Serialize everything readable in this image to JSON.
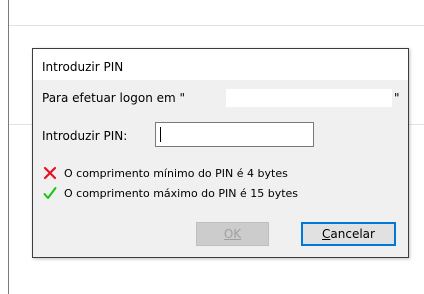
{
  "dialog": {
    "title": "Introduzir PIN",
    "target_label": "Para efetuar logon em \"",
    "target_value": "",
    "target_label_end": "\"",
    "pin_label": "Introduzir PIN:",
    "pin_value": "",
    "rules": [
      {
        "icon": "red-x-icon",
        "text": "O comprimento mínimo do PIN é 4 bytes",
        "status": "failed",
        "color": "#e81123"
      },
      {
        "icon": "green-check-icon",
        "text": "O comprimento máximo do PIN é 15 bytes",
        "status": "passed",
        "color": "#16c60c"
      }
    ],
    "ok_label": "OK",
    "ok_enabled": false,
    "cancel_label": "Cancelar"
  }
}
